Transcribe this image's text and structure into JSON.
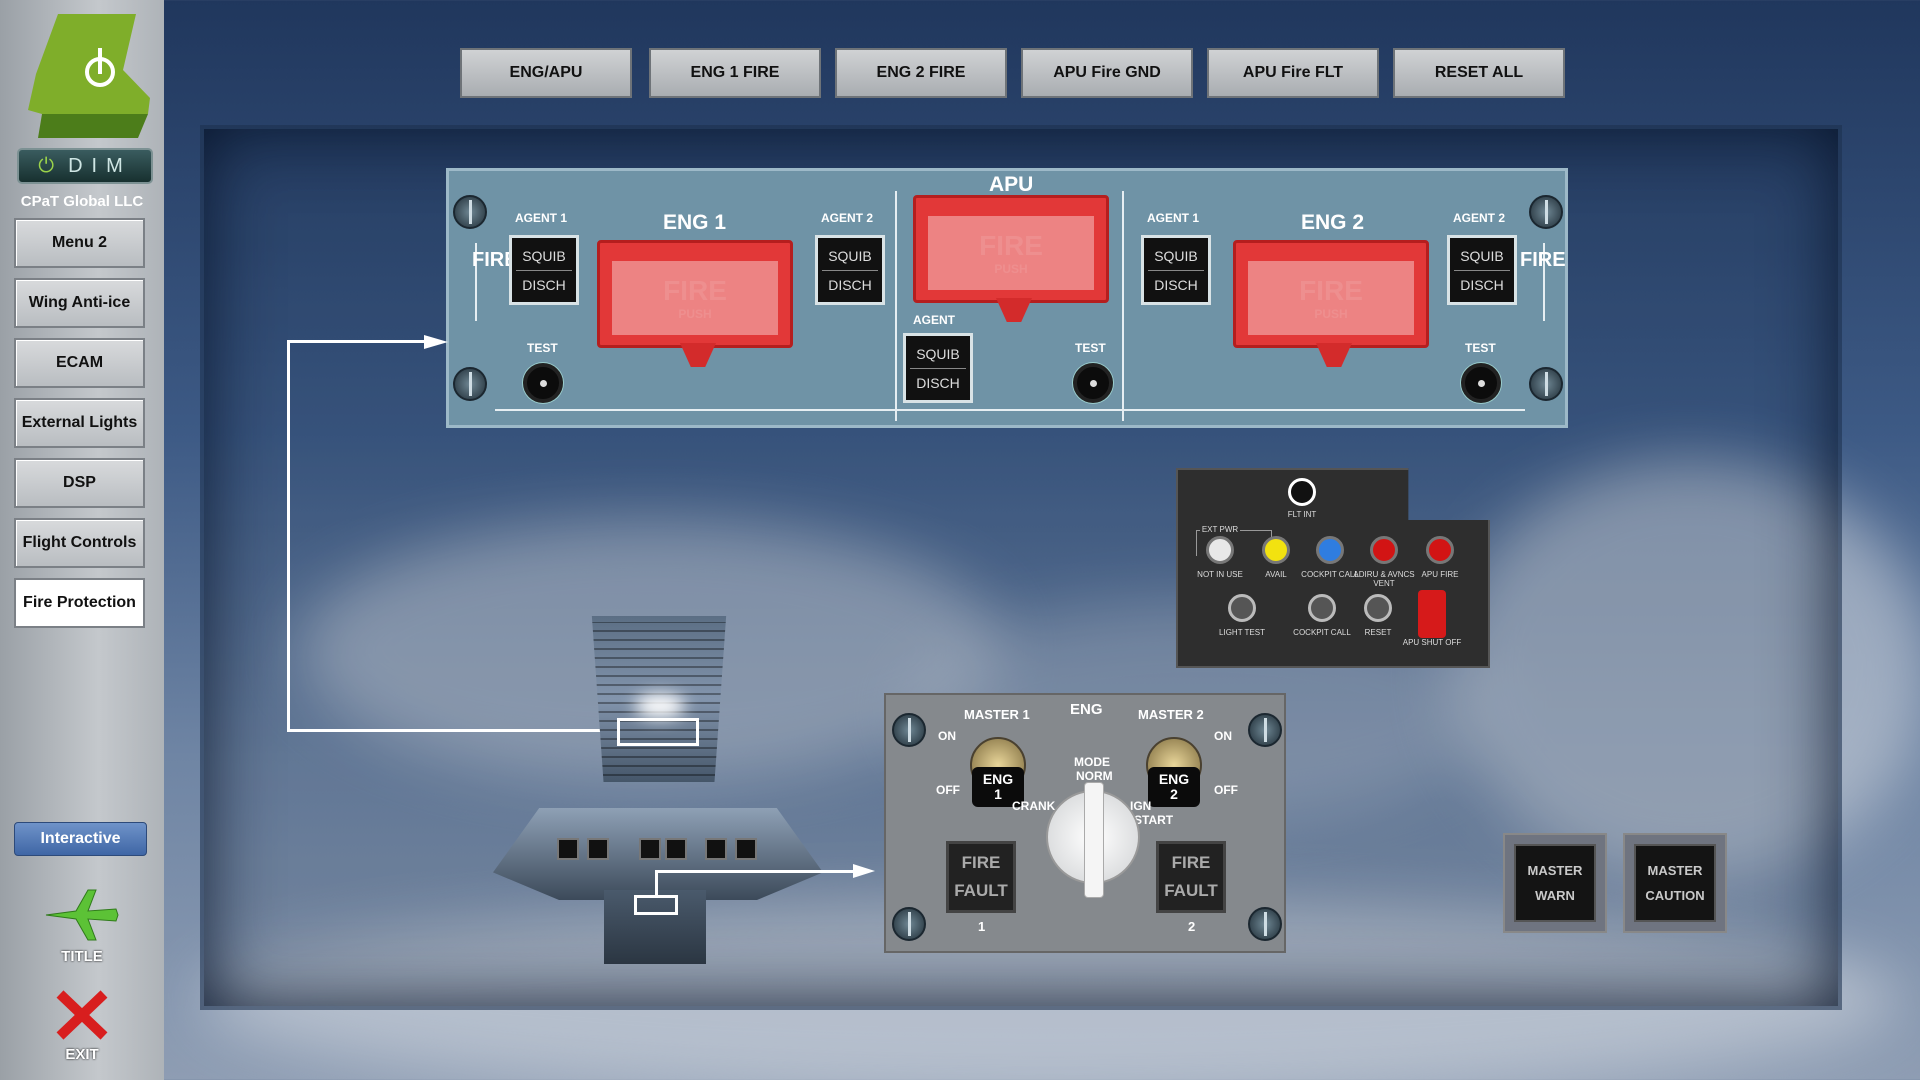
{
  "app": {
    "company": "CPaT Global LLC",
    "dim_label": "DIM"
  },
  "sidebar": {
    "items": [
      {
        "label": "Menu 2"
      },
      {
        "label": "Wing Anti-ice"
      },
      {
        "label": "ECAM"
      },
      {
        "label": "External Lights"
      },
      {
        "label": "DSP"
      },
      {
        "label": "Flight Controls"
      },
      {
        "label": "Fire Protection",
        "active": true
      }
    ],
    "interactive_label": "Interactive",
    "title_label": "TITLE",
    "exit_label": "EXIT"
  },
  "tabs": [
    {
      "label": "ENG/APU"
    },
    {
      "label": "ENG 1 FIRE"
    },
    {
      "label": "ENG 2 FIRE"
    },
    {
      "label": "APU Fire GND"
    },
    {
      "label": "APU Fire FLT"
    },
    {
      "label": "RESET ALL"
    }
  ],
  "fire_panel": {
    "fire_vertical": "FIRE",
    "agent1": "AGENT 1",
    "agent2": "AGENT 2",
    "agent": "AGENT",
    "squib": "SQUIB",
    "disch": "DISCH",
    "test": "TEST",
    "eng1": "ENG 1",
    "eng2": "ENG 2",
    "apu": "APU",
    "fire": "FIRE",
    "push": "PUSH"
  },
  "apu_panel": {
    "flt_int": "FLT INT",
    "ext_pwr": "EXT PWR",
    "not_in_use": "NOT IN USE",
    "avail": "AVAIL",
    "cockpit_call": "COCKPIT CALL",
    "adiru": "ADIRU & AVNCS VENT",
    "apu_fire": "APU FIRE",
    "light_test": "LIGHT TEST",
    "reset": "RESET",
    "apu_shut_off": "APU SHUT OFF",
    "colors": {
      "white": "#e8e8e8",
      "yellow": "#f2e210",
      "blue": "#2f7de0",
      "red": "#d21414"
    }
  },
  "eng_panel": {
    "title": "ENG",
    "master1": "MASTER 1",
    "master2": "MASTER 2",
    "on": "ON",
    "off": "OFF",
    "eng1_cap": "ENG\n1",
    "eng2_cap": "ENG\n2",
    "mode": "MODE",
    "norm": "NORM",
    "crank": "CRANK",
    "ign": "IGN",
    "start": "START",
    "fire": "FIRE",
    "fault": "FAULT",
    "num1": "1",
    "num2": "2"
  },
  "master": {
    "warn_top": "MASTER",
    "warn_bottom": "WARN",
    "caution_top": "MASTER",
    "caution_bottom": "CAUTION"
  }
}
